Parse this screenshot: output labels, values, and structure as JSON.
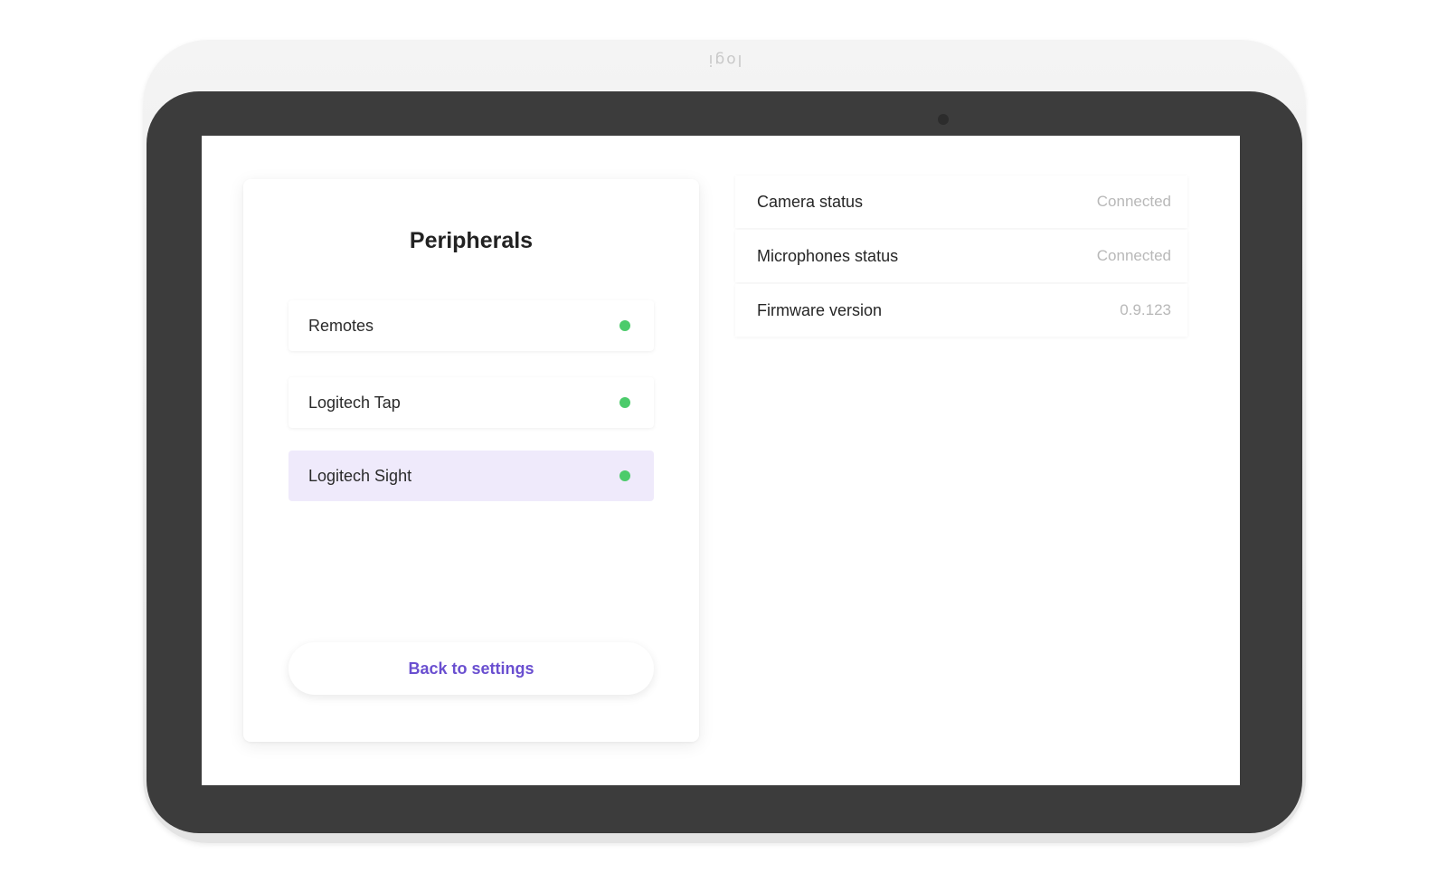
{
  "device": {
    "logo": "logi"
  },
  "peripherals": {
    "title": "Peripherals",
    "items": [
      {
        "label": "Remotes",
        "status_color": "#4ccb6b",
        "selected": false
      },
      {
        "label": "Logitech Tap",
        "status_color": "#4ccb6b",
        "selected": false
      },
      {
        "label": "Logitech Sight",
        "status_color": "#4ccb6b",
        "selected": true
      }
    ],
    "back_label": "Back to settings"
  },
  "details": {
    "rows": [
      {
        "label": "Camera status",
        "value": "Connected"
      },
      {
        "label": "Microphones status",
        "value": "Connected"
      },
      {
        "label": "Firmware version",
        "value": "0.9.123"
      }
    ]
  },
  "colors": {
    "accent": "#6a4fd0",
    "selected_bg": "#efeafb",
    "status_ok": "#4ccb6b",
    "bezel": "#3c3c3c"
  }
}
